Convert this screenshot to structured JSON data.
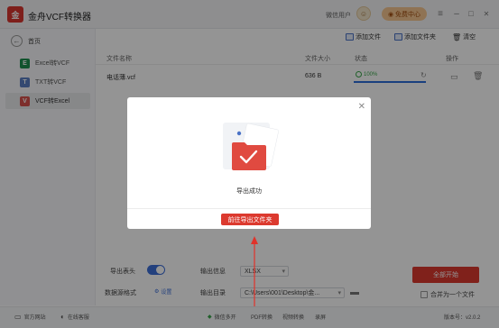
{
  "app": {
    "title": "金舟VCF转换器",
    "logo": "金",
    "user_label": "微信用户",
    "vip_label": "免费中心"
  },
  "window_controls": {
    "menu": "≡",
    "minimize": "–",
    "maximize": "□",
    "close": "✕"
  },
  "sidebar": {
    "home_label": "首页",
    "items": [
      {
        "badge": "E",
        "badge_color": "#1e8f4e",
        "label": "Excel转VCF"
      },
      {
        "badge": "T",
        "badge_color": "#5a7ec3",
        "label": "TXT转VCF"
      },
      {
        "badge": "V",
        "badge_color": "#d8514d",
        "label": "VCF转Excel"
      }
    ]
  },
  "toolbar": {
    "add_file": "添加文件",
    "add_folder": "添加文件夹",
    "clear": "清空"
  },
  "table": {
    "headers": {
      "name": "文件名称",
      "size": "文件大小",
      "status": "状态",
      "action": "操作"
    },
    "rows": [
      {
        "name": "电话薄.vcf",
        "size": "636 B",
        "status": "100%"
      }
    ]
  },
  "modal": {
    "message": "导出成功",
    "button": "前往导出文件夹"
  },
  "settings": {
    "export_header_label": "导出表头",
    "data_format_label": "数据源格式",
    "data_format_link": "设置",
    "output_info_label": "输出信息",
    "output_info_value": "XLSX",
    "output_dir_label": "输出目录",
    "output_dir_value": "C:\\Users\\001\\Desktop\\金...",
    "start_button": "全部开始",
    "merge_label": "合并为一个文件"
  },
  "statusbar": {
    "website": "官方网站",
    "support": "在线客服",
    "wechat_multi": "微信多开",
    "pdf_convert": "PDF转换",
    "video_convert": "视频转换",
    "recording": "录屏",
    "version": "版本号：v2.0.2"
  },
  "colors": {
    "accent": "#dc3a2f",
    "blue": "#3d6fd8"
  }
}
